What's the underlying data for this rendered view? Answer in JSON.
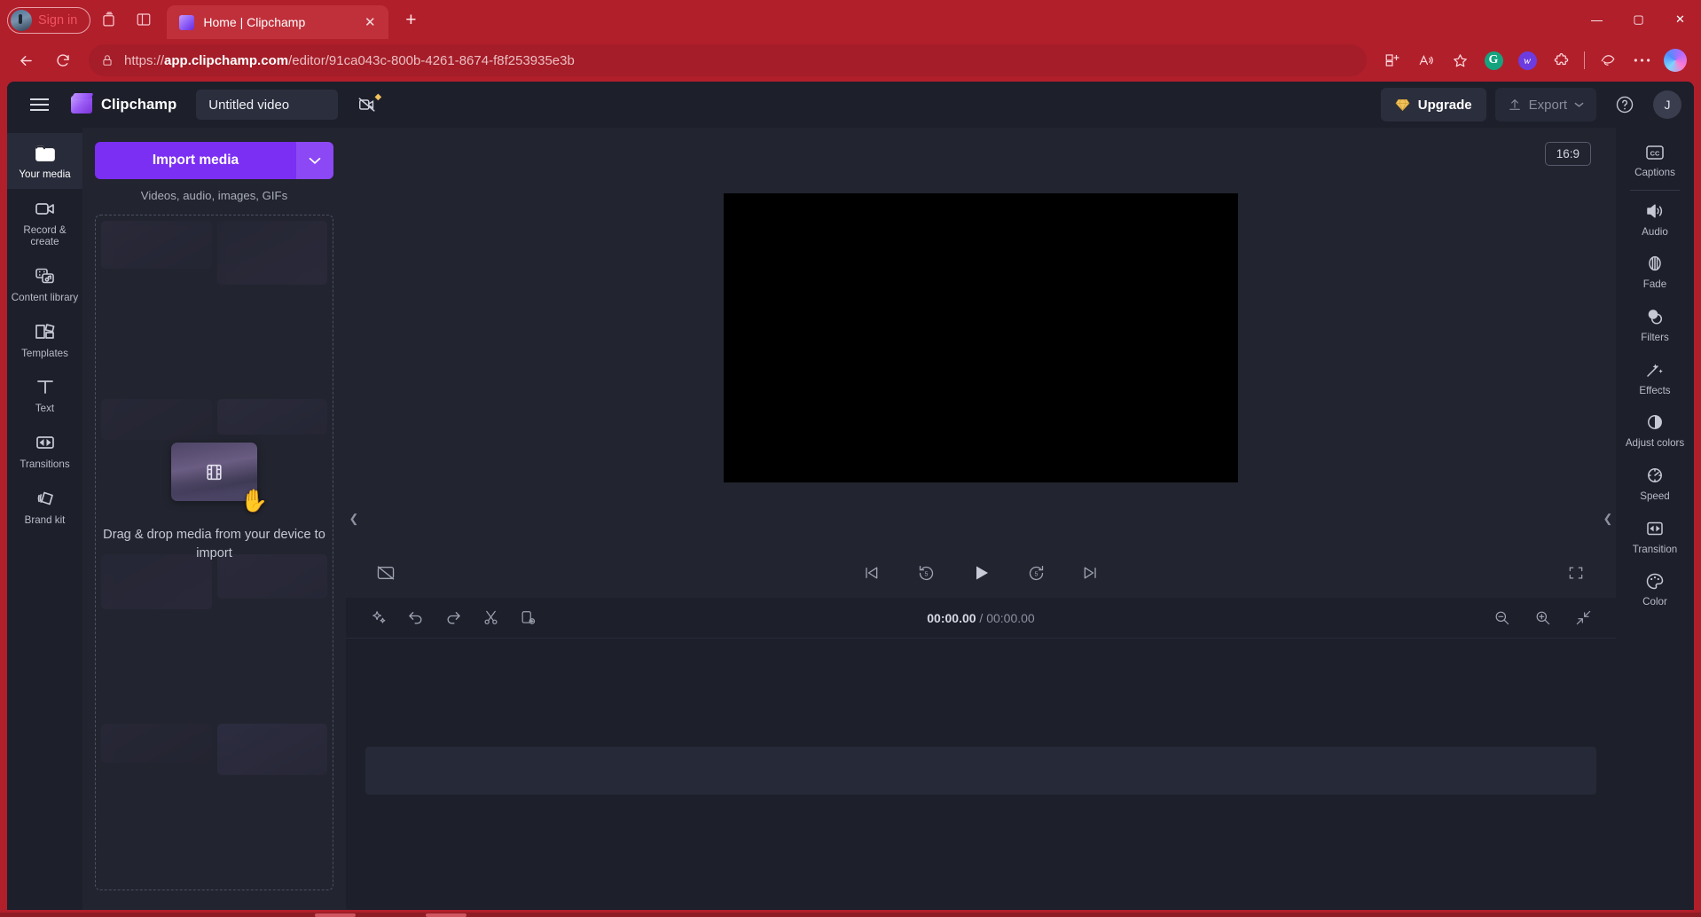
{
  "browser": {
    "signin_label": "Sign in",
    "tab": {
      "title": "Home | Clipchamp",
      "close": "✕"
    },
    "newtab_label": "+",
    "window_controls": {
      "minimize": "—",
      "maximize": "▢",
      "close": "✕"
    },
    "url_prefix": "https://",
    "url_domain": "app.clipchamp.com",
    "url_path": "/editor/91ca043c-800b-4261-8674-f8f253935e3b",
    "extensions": {
      "grammarly": "G",
      "wallet": "w"
    }
  },
  "app": {
    "brand": "Clipchamp",
    "project_title": "Untitled video",
    "upgrade_label": "Upgrade",
    "export_label": "Export",
    "help_label": "?",
    "avatar_initial": "J"
  },
  "left_rail": [
    {
      "label": "Your media",
      "icon": "folder-icon",
      "active": true
    },
    {
      "label": "Record & create",
      "icon": "camera-icon",
      "active": false
    },
    {
      "label": "Content library",
      "icon": "library-icon",
      "active": false
    },
    {
      "label": "Templates",
      "icon": "templates-icon",
      "active": false
    },
    {
      "label": "Text",
      "icon": "text-icon",
      "active": false
    },
    {
      "label": "Transitions",
      "icon": "transitions-icon",
      "active": false
    },
    {
      "label": "Brand kit",
      "icon": "brandkit-icon",
      "active": false
    }
  ],
  "media_panel": {
    "import_label": "Import media",
    "import_caret": "⌄",
    "import_subtitle": "Videos, audio, images, GIFs",
    "dropzone_text": "Drag & drop media from your device to import",
    "cursor": "✋"
  },
  "stage": {
    "aspect_ratio": "16:9"
  },
  "player": {
    "captions_toggle": "captions-off-icon",
    "skip_back": "skip-back-icon",
    "rewind": "rewind-5-icon",
    "play": "play-icon",
    "forward": "forward-5-icon",
    "skip_forward": "skip-forward-icon",
    "fullscreen": "fullscreen-icon"
  },
  "timeline": {
    "tools": [
      "magic-icon",
      "undo-icon",
      "redo-icon",
      "split-icon",
      "duplicate-icon"
    ],
    "current_time": "00:00.00",
    "separator": " / ",
    "total_time": "00:00.00",
    "zoom_out": "zoom-out-icon",
    "zoom_in": "zoom-in-icon",
    "fit": "fit-icon"
  },
  "right_rail": [
    {
      "label": "Captions",
      "icon": "cc-icon"
    },
    {
      "label": "Audio",
      "icon": "speaker-icon"
    },
    {
      "label": "Fade",
      "icon": "fade-icon"
    },
    {
      "label": "Filters",
      "icon": "filters-icon"
    },
    {
      "label": "Effects",
      "icon": "wand-icon"
    },
    {
      "label": "Adjust colors",
      "icon": "contrast-icon"
    },
    {
      "label": "Speed",
      "icon": "speedometer-icon"
    },
    {
      "label": "Transition",
      "icon": "transition-icon"
    },
    {
      "label": "Color",
      "icon": "palette-icon"
    }
  ],
  "colors": {
    "browser_red": "#b11f2b",
    "app_bg": "#1d1f2b",
    "panel_bg": "#22242f",
    "accent_purple": "#7b2ff2",
    "gold": "#f2c25b"
  }
}
